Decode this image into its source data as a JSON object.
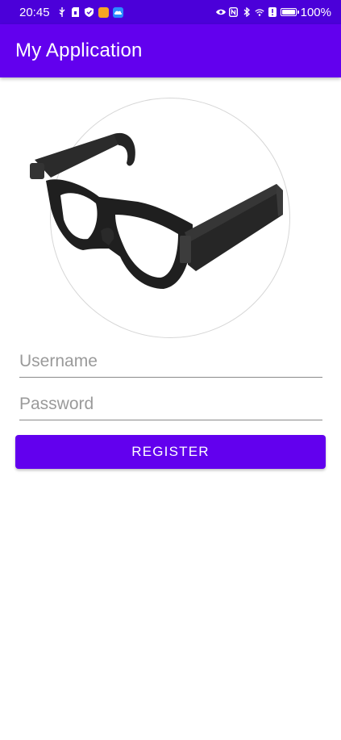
{
  "status_bar": {
    "time": "20:45",
    "battery_percent": "100%",
    "battery_level": 1.0,
    "colors": {
      "background": "#4b00d9",
      "notification_app_1": "#f5a623",
      "notification_app_2": "#2a8cff"
    }
  },
  "app_bar": {
    "title": "My Application",
    "color": "#6200ee"
  },
  "product_image": {
    "icon": "smart-glasses-image"
  },
  "form": {
    "username_placeholder": "Username",
    "username_value": "",
    "password_placeholder": "Password",
    "password_value": "",
    "register_label": "REGISTER",
    "accent_color": "#6200ee"
  }
}
